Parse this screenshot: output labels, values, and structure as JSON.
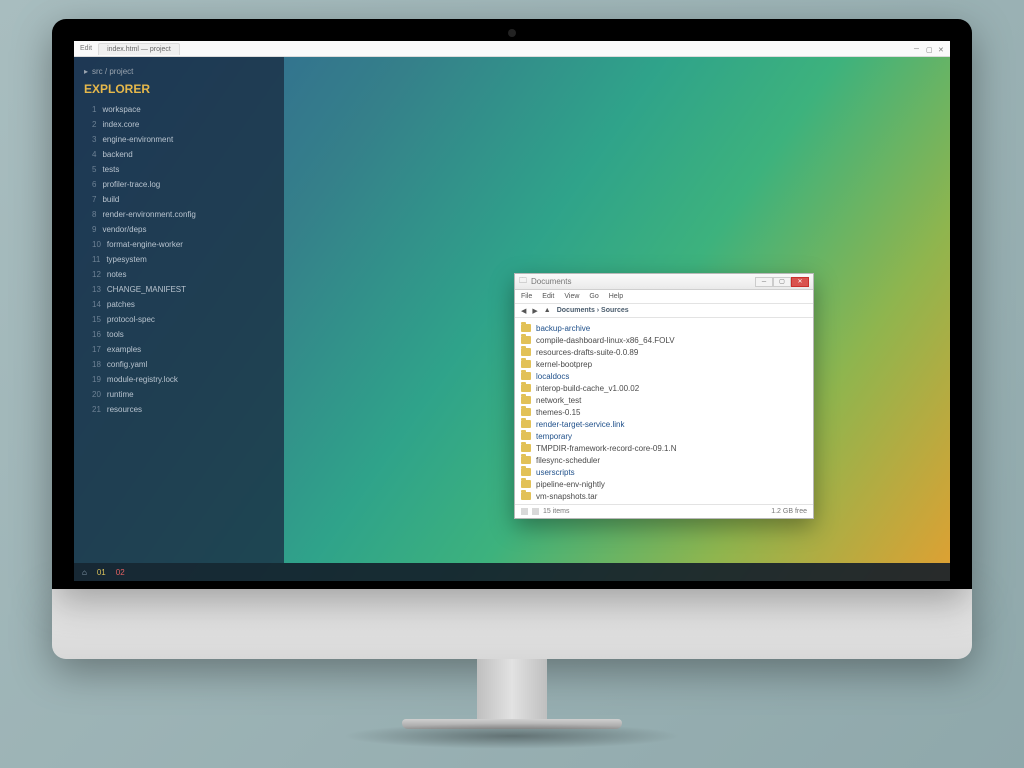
{
  "titlebar": {
    "app_hint": "Edit",
    "tab": "index.html — project",
    "right_icons": [
      "minimize",
      "maximize",
      "close"
    ]
  },
  "sidebar": {
    "breadcrumb": "src / project",
    "brand": "EXPLORER",
    "items": [
      {
        "num": "1",
        "label": "workspace"
      },
      {
        "num": "2",
        "label": "index.core"
      },
      {
        "num": "3",
        "label": "engine-environment"
      },
      {
        "num": "4",
        "label": "backend"
      },
      {
        "num": "5",
        "label": "tests"
      },
      {
        "num": "6",
        "label": "profiler-trace.log"
      },
      {
        "num": "7",
        "label": "build"
      },
      {
        "num": "8",
        "label": "render-environment.config"
      },
      {
        "num": "9",
        "label": "vendor/deps"
      },
      {
        "num": "10",
        "label": "format-engine-worker"
      },
      {
        "num": "11",
        "label": "typesystem"
      },
      {
        "num": "12",
        "label": "notes"
      },
      {
        "num": "13",
        "label": "CHANGE_MANIFEST"
      },
      {
        "num": "14",
        "label": "patches"
      },
      {
        "num": "15",
        "label": "protocol-spec"
      },
      {
        "num": "16",
        "label": "tools"
      },
      {
        "num": "17",
        "label": "examples"
      },
      {
        "num": "18",
        "label": "config.yaml"
      },
      {
        "num": "19",
        "label": "module-registry.lock"
      },
      {
        "num": "20",
        "label": "runtime"
      },
      {
        "num": "21",
        "label": "resources"
      }
    ]
  },
  "taskbar": {
    "items": [
      "⌂",
      "01",
      "02"
    ]
  },
  "explorer": {
    "title": "Documents",
    "menu": [
      "File",
      "Edit",
      "View",
      "Go",
      "Help"
    ],
    "toolbar": {
      "nav1": "◀",
      "nav2": "▶",
      "up": "▲",
      "desc": "Documents › Sources"
    },
    "entries": [
      {
        "name": "backup-archive",
        "alt": false
      },
      {
        "name": "compile-dashboard-linux-x86_64.FOLV",
        "alt": true
      },
      {
        "name": "resources-drafts-suite-0.0.89",
        "alt": true
      },
      {
        "name": "kernel-bootprep",
        "alt": true
      },
      {
        "name": "localdocs",
        "alt": false
      },
      {
        "name": "interop-build-cache_v1.00.02",
        "alt": true
      },
      {
        "name": "network_test",
        "alt": true
      },
      {
        "name": "themes-0.15",
        "alt": true
      },
      {
        "name": "render-target-service.link",
        "alt": false
      },
      {
        "name": "temporary",
        "alt": false
      },
      {
        "name": "TMPDIR-framework-record-core-09.1.N",
        "alt": true
      },
      {
        "name": "filesync-scheduler",
        "alt": true
      },
      {
        "name": "userscripts",
        "alt": false
      },
      {
        "name": "pipeline-env-nightly",
        "alt": true
      },
      {
        "name": "vm-snapshots.tar",
        "alt": true
      }
    ],
    "status": {
      "left": "15 items",
      "count_label": "15",
      "right": "1.2 GB free"
    }
  }
}
